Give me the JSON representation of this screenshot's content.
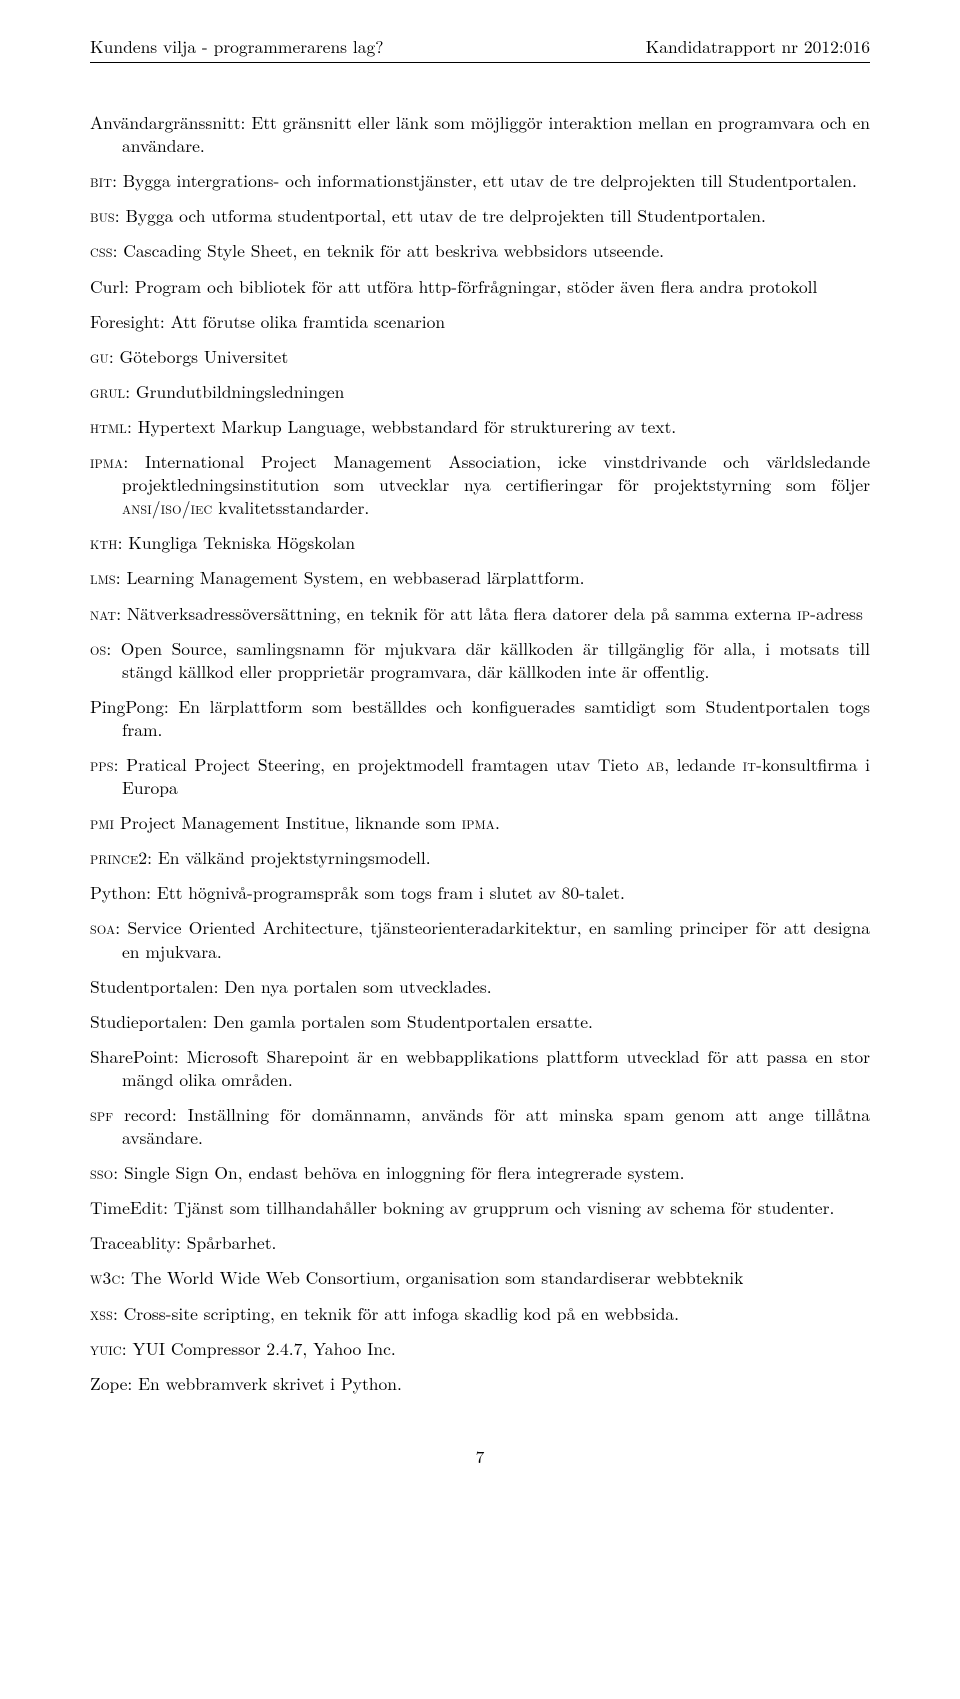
{
  "header": {
    "left": "Kundens vilja - programmerarens lag?",
    "right": "Kandidatrapport nr 2012:016"
  },
  "defs": {
    "d0": "Användargränssnitt: Ett gränsnitt eller länk som möjliggör interaktion mellan en programvara och en användare.",
    "d1a": "bit",
    "d1b": ": Bygga intergrations- och informationstjänster, ett utav de tre delprojekten till Studentportalen.",
    "d2a": "bus",
    "d2b": ": Bygga och utforma studentportal, ett utav de tre delprojekten till Studentportalen.",
    "d3a": "css",
    "d3b": ": Cascading Style Sheet, en teknik för att beskriva webbsidors utseende.",
    "d4": "Curl: Program och bibliotek för att utföra http-förfrågningar, stöder även flera andra protokoll",
    "d5": "Foresight: Att förutse olika framtida scenarion",
    "d6a": "gu",
    "d6b": ": Göteborgs Universitet",
    "d7a": "grul",
    "d7b": ": Grundutbildningsledningen",
    "d8a": "html",
    "d8b": ": Hypertext Markup Language, webbstandard för strukturering av text.",
    "d9a": "ipma",
    "d9b": ": International Project Management Association, icke vinstdrivande och världsledande projektledningsinstitution som utvecklar nya certifieringar för projektstyrning som följer ",
    "d9c": "ansi/iso/iec",
    "d9d": " kvalitetsstandarder.",
    "d10a": "kth",
    "d10b": ": Kungliga Tekniska Högskolan",
    "d11a": "lms",
    "d11b": ": Learning Management System, en webbaserad lärplattform.",
    "d12a": "nat",
    "d12b": ": Nätverksadressöversättning, en teknik för att låta flera datorer dela på samma externa ",
    "d12c": "ip",
    "d12d": "-adress",
    "d13a": "os",
    "d13b": ": Open Source, samlingsnamn för mjukvara där källkoden är tillgänglig för alla, i motsats till stängd källkod eller propprietär programvara, där källkoden inte är offentlig.",
    "d14": "PingPong: En lärplattform som beställdes och konfiguerades samtidigt som Studentportalen togs fram.",
    "d15a": "pps",
    "d15b": ": Pratical Project Steering, en projektmodell framtagen utav Tieto ",
    "d15c": "ab",
    "d15d": ", ledande ",
    "d15e": "it",
    "d15f": "-konsultfirma i Europa",
    "d16a": "pmi",
    "d16b": " Project Management Institue, liknande som ",
    "d16c": "ipma",
    "d16d": ".",
    "d17a": "prince",
    "d17b": "2: En välkänd projektstyrningsmodell.",
    "d18": "Python: Ett högnivå-programspråk som togs fram i slutet av 80-talet.",
    "d19a": "soa",
    "d19b": ": Service Oriented Architecture, tjänsteorienteradarkitektur, en samling principer för att designa en mjukvara.",
    "d20": "Studentportalen: Den nya portalen som utvecklades.",
    "d21": "Studieportalen: Den gamla portalen som Studentportalen ersatte.",
    "d22": "SharePoint: Microsoft Sharepoint är en webbapplikations plattform utvecklad för att passa en stor mängd olika områden.",
    "d23a": "spf",
    "d23b": " record: Inställning för domännamn, används för att minska spam genom att ange tillåtna avsändare.",
    "d24a": "sso",
    "d24b": ": Single Sign On, endast behöva en inloggning för flera integrerade system.",
    "d25": "TimeEdit: Tjänst som tillhandahåller bokning av grupprum och visning av schema för studenter.",
    "d26": "Traceablity: Spårbarhet.",
    "d27a": "w3c",
    "d27b": ": The World Wide Web Consortium, organisation som standardiserar webbteknik",
    "d28a": "xss",
    "d28b": ": Cross-site scripting, en teknik för att infoga skadlig kod på en webbsida.",
    "d29a": "yuic",
    "d29b": ": YUI Compressor 2.4.7, Yahoo Inc.",
    "d30": "Zope: En webbramverk skrivet i Python."
  },
  "page_number": "7"
}
